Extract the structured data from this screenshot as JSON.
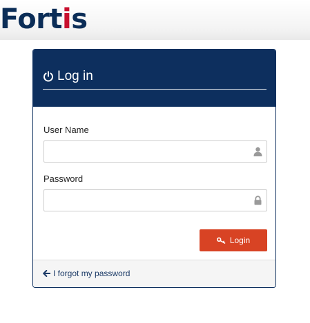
{
  "brand": {
    "name_prefix": "Fort",
    "name_accent": "i",
    "name_suffix": "s",
    "primary_color": "#0b2d57",
    "accent_color": "#c8102e"
  },
  "login_panel": {
    "title": "Log in",
    "title_icon": "power-icon",
    "header_color": "#0d2f5e",
    "username": {
      "label": "User Name",
      "value": "",
      "placeholder": "",
      "icon": "user-icon"
    },
    "password": {
      "label": "Password",
      "value": "",
      "placeholder": "",
      "icon": "lock-icon"
    },
    "submit": {
      "label": "Login",
      "icon": "key-icon",
      "color": "#d84324"
    },
    "forgot_password": {
      "label": "I forgot my password",
      "icon": "arrow-left-icon"
    }
  }
}
